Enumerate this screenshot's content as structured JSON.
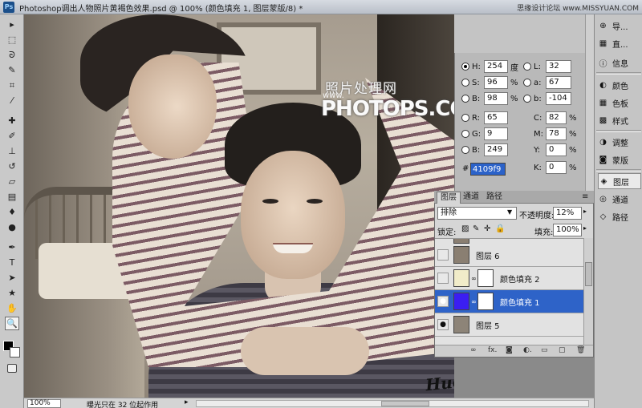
{
  "window": {
    "title": "Photoshop调出人物照片黄褐色效果.psd @ 100% (颜色填充 1, 图层蒙版/8) *",
    "site_mark": "思缘设计论坛 www.MISSYUAN.COM"
  },
  "toolbox": {
    "tools": [
      {
        "name": "move-tool-icon",
        "glyph": "▸"
      },
      {
        "name": "marquee-tool-icon",
        "glyph": "⬚"
      },
      {
        "name": "lasso-tool-icon",
        "glyph": "ᘐ"
      },
      {
        "name": "quick-select-tool-icon",
        "glyph": "✎"
      },
      {
        "name": "crop-tool-icon",
        "glyph": "⌗"
      },
      {
        "name": "eyedropper-tool-icon",
        "glyph": "⁄"
      },
      {
        "name": "healing-brush-tool-icon",
        "glyph": "✚"
      },
      {
        "name": "brush-tool-icon",
        "glyph": "✐"
      },
      {
        "name": "clone-stamp-tool-icon",
        "glyph": "⊥"
      },
      {
        "name": "history-brush-tool-icon",
        "glyph": "↺"
      },
      {
        "name": "eraser-tool-icon",
        "glyph": "▱"
      },
      {
        "name": "gradient-tool-icon",
        "glyph": "▤"
      },
      {
        "name": "blur-tool-icon",
        "glyph": "♦"
      },
      {
        "name": "dodge-tool-icon",
        "glyph": "●"
      },
      {
        "name": "pen-tool-icon",
        "glyph": "✒"
      },
      {
        "name": "type-tool-icon",
        "glyph": "T"
      },
      {
        "name": "path-select-tool-icon",
        "glyph": "➤"
      },
      {
        "name": "shape-tool-icon",
        "glyph": "★"
      },
      {
        "name": "hand-tool-icon",
        "glyph": "✋"
      },
      {
        "name": "zoom-tool-icon",
        "glyph": "🔍"
      }
    ]
  },
  "canvas": {
    "watermark_cn": "照片处理网",
    "watermark_www": "www.",
    "watermark_en": "PHOTOPS.COM",
    "signature": "Huosharizuo"
  },
  "status": {
    "zoom": "100%",
    "text": "曝光只在 32 位起作用",
    "arrow": "▸"
  },
  "picker": {
    "fields": [
      {
        "label": "H:",
        "value": "254",
        "unit": "度",
        "radio": true
      },
      {
        "label": "S:",
        "value": "96",
        "unit": "%",
        "radio": false
      },
      {
        "label": "B:",
        "value": "98",
        "unit": "%",
        "radio": false
      },
      {
        "label": "R:",
        "value": "65",
        "unit": "",
        "radio": false
      },
      {
        "label": "G:",
        "value": "9",
        "unit": "",
        "radio": false
      },
      {
        "label": "B:",
        "value": "249",
        "unit": "",
        "radio": false
      }
    ],
    "lab_fields": [
      {
        "label": "L:",
        "value": "32"
      },
      {
        "label": "a:",
        "value": "67"
      },
      {
        "label": "b:",
        "value": "-104"
      }
    ],
    "cmyk_fields": [
      {
        "label": "C:",
        "value": "82",
        "unit": "%"
      },
      {
        "label": "M:",
        "value": "78",
        "unit": "%"
      },
      {
        "label": "Y:",
        "value": "0",
        "unit": "%"
      },
      {
        "label": "K:",
        "value": "0",
        "unit": "%"
      }
    ],
    "hex_label": "#",
    "hex": "4109f9"
  },
  "dock": {
    "items": [
      {
        "name": "dock-navigator",
        "label": "导...",
        "icon": "⊕"
      },
      {
        "name": "dock-histogram",
        "label": "直...",
        "icon": "▦"
      },
      {
        "name": "dock-info",
        "label": "信息",
        "icon": "ⓘ"
      },
      {
        "name": "dock-color",
        "label": "颜色",
        "icon": "◐"
      },
      {
        "name": "dock-swatches",
        "label": "色板",
        "icon": "▦"
      },
      {
        "name": "dock-styles",
        "label": "样式",
        "icon": "▩"
      },
      {
        "name": "dock-adjustments",
        "label": "调整",
        "icon": "◑"
      },
      {
        "name": "dock-masks",
        "label": "蒙版",
        "icon": "◙"
      },
      {
        "name": "dock-layers",
        "label": "图层",
        "icon": "◈"
      },
      {
        "name": "dock-channels",
        "label": "通道",
        "icon": "◎"
      },
      {
        "name": "dock-paths",
        "label": "路径",
        "icon": "◇"
      }
    ],
    "selected": "图层"
  },
  "layers": {
    "tabs": [
      "图层",
      "通道",
      "路径"
    ],
    "blend_mode": "排除",
    "opacity_label": "不透明度:",
    "opacity": "12%",
    "lock_label": "锁定:",
    "fill_label": "填充:",
    "fill": "100%",
    "rows": [
      {
        "name": "图层 6",
        "visible": false,
        "thumb_color": "#8a7f72",
        "mask": false,
        "selected": false
      },
      {
        "name": "颜色填充 2",
        "visible": false,
        "thumb_color": "#f1ecc9",
        "mask": true,
        "selected": false
      },
      {
        "name": "颜色填充 1",
        "visible": true,
        "thumb_color": "#3b1ef2",
        "mask": true,
        "selected": true
      },
      {
        "name": "图层 5",
        "visible": true,
        "thumb_color": "#8d8478",
        "mask": false,
        "selected": false
      }
    ],
    "footer_icons": [
      "∞",
      "fx.",
      "◙",
      "◐.",
      "▭",
      "▢",
      "🗑"
    ]
  }
}
